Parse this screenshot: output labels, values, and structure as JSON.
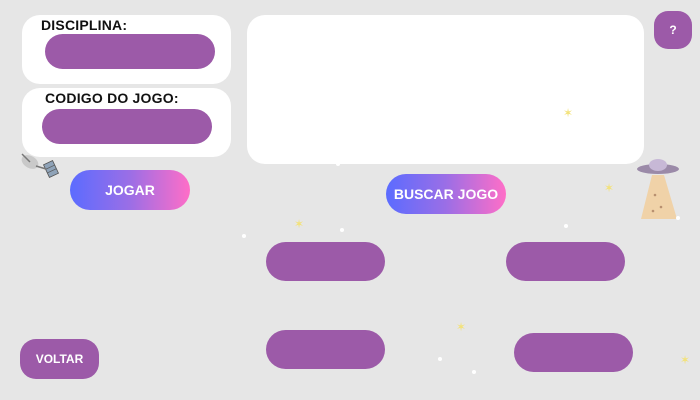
{
  "form": {
    "disciplina_label": "DISCIPLINA:",
    "disciplina_value": "",
    "codigo_label": "CODIGO DO JOGO:",
    "codigo_value": ""
  },
  "buttons": {
    "jogar": "JOGAR",
    "buscar": "BUSCAR JOGO",
    "voltar": "VOLTAR",
    "help": "?"
  },
  "results": {
    "option_1": "",
    "option_2": "",
    "option_3": "",
    "option_4": ""
  },
  "colors": {
    "accent": "#9c5aa8",
    "gradient_start": "#5b6cff",
    "gradient_end": "#ff6ec7",
    "background": "#e6e6e6"
  },
  "icons": [
    "satellite-icon",
    "ufo-icon",
    "star-icon"
  ]
}
